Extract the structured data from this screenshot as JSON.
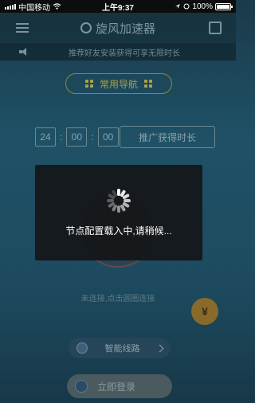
{
  "status_bar": {
    "carrier": "中国移动",
    "time": "上午9:37",
    "battery": "100%"
  },
  "header": {
    "title": "旋风加速器"
  },
  "notice": {
    "text": "推荐好友安装获得可享无限时长"
  },
  "nav": {
    "label": "常用导航"
  },
  "timer": {
    "hours": "24",
    "minutes": "00",
    "seconds": "00",
    "separator": ":",
    "promo_label": "推广获得时长"
  },
  "connect": {
    "hint": "未连接,点击圆圈连接"
  },
  "yuan_button": {
    "label": "¥"
  },
  "route": {
    "label": "智能线路"
  },
  "login": {
    "label": "立即登录"
  },
  "loading": {
    "text": "节点配置载入中,请稍候..."
  },
  "colors": {
    "background": "#1f5166",
    "accent_gold": "#a9a24a",
    "overlay": "#141618"
  },
  "icons": [
    "menu-icon",
    "logo-icon",
    "share-icon",
    "speaker-icon",
    "grid-icon",
    "spinner-icon",
    "route-icon",
    "chevron-right-icon",
    "login-icon",
    "wifi-icon",
    "battery-icon"
  ]
}
